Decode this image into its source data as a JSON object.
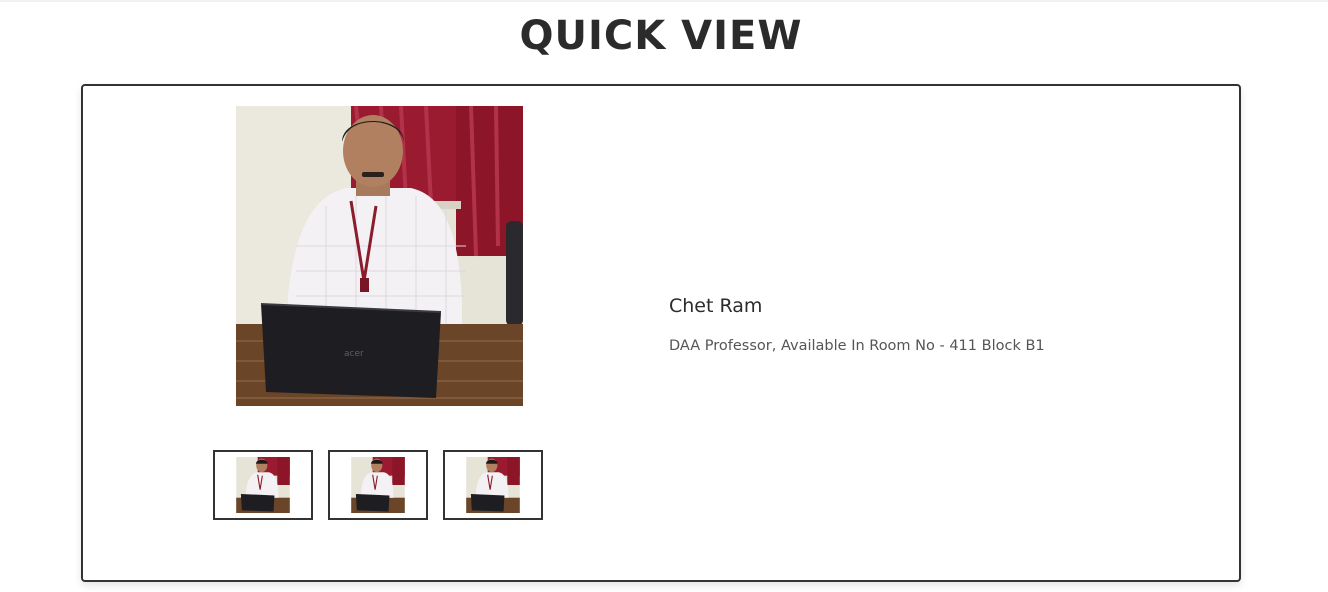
{
  "page": {
    "title": "QUICK VIEW"
  },
  "person": {
    "name": "Chet Ram",
    "description": "DAA Professor, Available In Room No - 411 Block B1",
    "photo_alt": "Photo of Chet Ram"
  },
  "thumbnails": [
    {
      "label": "thumbnail 1"
    },
    {
      "label": "thumbnail 2"
    },
    {
      "label": "thumbnail 3"
    }
  ],
  "colors": {
    "title": "#2b2b2b",
    "card_border": "#333333",
    "curtain": "#a0182f",
    "laptop": "#1e1e22",
    "desk": "#6e4a2c",
    "wall": "#e8e6da"
  }
}
